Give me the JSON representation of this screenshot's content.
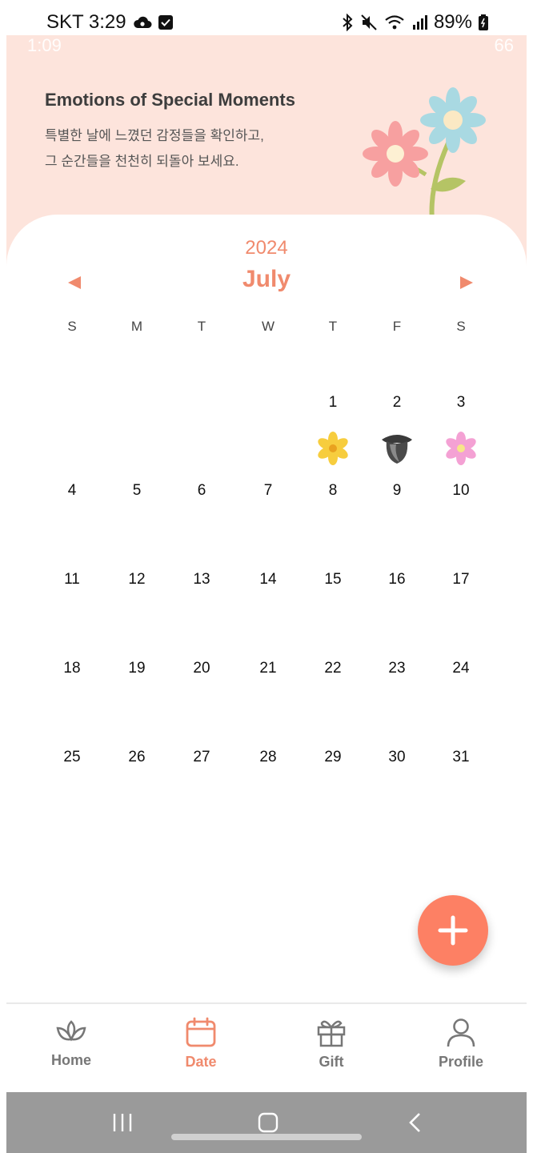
{
  "status_bar": {
    "carrier_time": "SKT 3:29",
    "battery": "89%",
    "ghost_time": "1:09",
    "ghost_battery": "66"
  },
  "header": {
    "title": "Emotions of Special Moments",
    "subtitle_line1": "특별한 날에 느꼈던 감정들을 확인하고,",
    "subtitle_line2": "그 순간들을 천천히 되돌아 보세요."
  },
  "calendar": {
    "year": "2024",
    "month": "July",
    "weekdays": [
      "S",
      "M",
      "T",
      "W",
      "T",
      "F",
      "S"
    ],
    "days": [
      "1",
      "2",
      "3",
      "4",
      "5",
      "6",
      "7",
      "8",
      "9",
      "10",
      "11",
      "12",
      "13",
      "14",
      "15",
      "16",
      "17",
      "18",
      "19",
      "20",
      "21",
      "22",
      "23",
      "24",
      "25",
      "26",
      "27",
      "28",
      "29",
      "30",
      "31"
    ],
    "moods": [
      {
        "day": "1",
        "icon": "yellow-flower-icon"
      },
      {
        "day": "2",
        "icon": "black-flower-icon"
      },
      {
        "day": "3",
        "icon": "pink-flower-icon"
      }
    ]
  },
  "bottom_nav": [
    {
      "label": "Home",
      "icon": "lotus-icon",
      "active": false
    },
    {
      "label": "Date",
      "icon": "calendar-icon",
      "active": true
    },
    {
      "label": "Gift",
      "icon": "gift-icon",
      "active": false
    },
    {
      "label": "Profile",
      "icon": "person-icon",
      "active": false
    }
  ],
  "colors": {
    "accent": "#f08a6d",
    "fab": "#fd8064",
    "header_bg": "#fde4dc",
    "nav_inactive": "#777777"
  }
}
